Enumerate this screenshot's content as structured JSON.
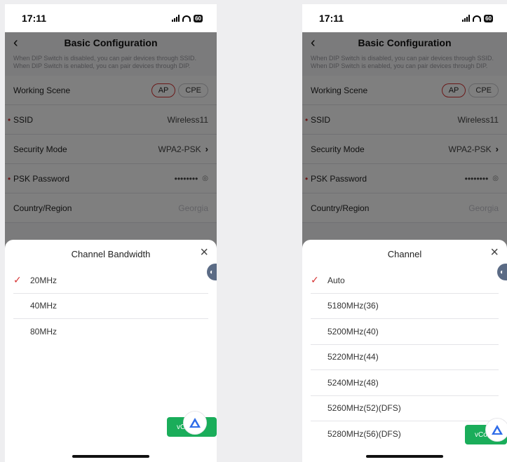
{
  "left_screen": {
    "status": {
      "time": "17:11",
      "battery": "60"
    },
    "header": {
      "back": "‹",
      "title": "Basic Configuration"
    },
    "notice": "When DIP Switch is disabled, you can pair devices through SSID. When DIP Switch is enabled, you can pair devices through DIP.",
    "rows": {
      "working_scene": {
        "label": "Working Scene",
        "opt_ap": "AP",
        "opt_cpe": "CPE"
      },
      "ssid": {
        "label": "SSID",
        "value": "Wireless11"
      },
      "security": {
        "label": "Security Mode",
        "value": "WPA2-PSK"
      },
      "psk": {
        "label": "PSK Password",
        "value": "••••••••"
      },
      "country": {
        "label": "Country/Region",
        "value": "Georgia"
      }
    },
    "sheet": {
      "title": "Channel Bandwidth",
      "close": "×",
      "options": [
        "20MHz",
        "40MHz",
        "80MHz"
      ],
      "selected": "20MHz"
    },
    "vconsole": "vCo"
  },
  "right_screen": {
    "status": {
      "time": "17:11",
      "battery": "60"
    },
    "header": {
      "back": "‹",
      "title": "Basic Configuration"
    },
    "notice": "When DIP Switch is disabled, you can pair devices through SSID. When DIP Switch is enabled, you can pair devices through DIP.",
    "rows": {
      "working_scene": {
        "label": "Working Scene",
        "opt_ap": "AP",
        "opt_cpe": "CPE"
      },
      "ssid": {
        "label": "SSID",
        "value": "Wireless11"
      },
      "security": {
        "label": "Security Mode",
        "value": "WPA2-PSK"
      },
      "psk": {
        "label": "PSK Password",
        "value": "••••••••"
      },
      "country": {
        "label": "Country/Region",
        "value": "Georgia"
      }
    },
    "sheet": {
      "title": "Channel",
      "close": "×",
      "options": [
        "Auto",
        "5180MHz(36)",
        "5200MHz(40)",
        "5220MHz(44)",
        "5240MHz(48)",
        "5260MHz(52)(DFS)",
        "5280MHz(56)(DFS)"
      ],
      "selected": "Auto"
    },
    "vconsole": "vCo"
  },
  "icons": {
    "check": "✓",
    "chevron": "›",
    "eye": "eye-slash-icon",
    "wifi": "wifi-icon",
    "signal": "signal-icon"
  },
  "colors": {
    "accent": "#d63333",
    "vconsole": "#1aad5a",
    "logo": "#2d6be8"
  }
}
